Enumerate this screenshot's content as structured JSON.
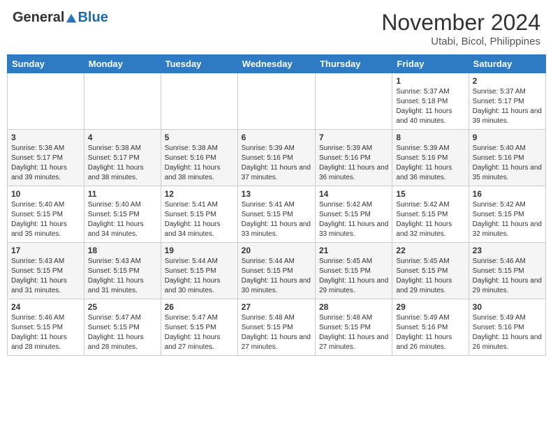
{
  "header": {
    "logo_general": "General",
    "logo_blue": "Blue",
    "month_title": "November 2024",
    "location": "Utabi, Bicol, Philippines"
  },
  "days_of_week": [
    "Sunday",
    "Monday",
    "Tuesday",
    "Wednesday",
    "Thursday",
    "Friday",
    "Saturday"
  ],
  "weeks": [
    [
      {
        "day": "",
        "info": ""
      },
      {
        "day": "",
        "info": ""
      },
      {
        "day": "",
        "info": ""
      },
      {
        "day": "",
        "info": ""
      },
      {
        "day": "",
        "info": ""
      },
      {
        "day": "1",
        "info": "Sunrise: 5:37 AM\nSunset: 5:18 PM\nDaylight: 11 hours and 40 minutes."
      },
      {
        "day": "2",
        "info": "Sunrise: 5:37 AM\nSunset: 5:17 PM\nDaylight: 11 hours and 39 minutes."
      }
    ],
    [
      {
        "day": "3",
        "info": "Sunrise: 5:38 AM\nSunset: 5:17 PM\nDaylight: 11 hours and 39 minutes."
      },
      {
        "day": "4",
        "info": "Sunrise: 5:38 AM\nSunset: 5:17 PM\nDaylight: 11 hours and 38 minutes."
      },
      {
        "day": "5",
        "info": "Sunrise: 5:38 AM\nSunset: 5:16 PM\nDaylight: 11 hours and 38 minutes."
      },
      {
        "day": "6",
        "info": "Sunrise: 5:39 AM\nSunset: 5:16 PM\nDaylight: 11 hours and 37 minutes."
      },
      {
        "day": "7",
        "info": "Sunrise: 5:39 AM\nSunset: 5:16 PM\nDaylight: 11 hours and 36 minutes."
      },
      {
        "day": "8",
        "info": "Sunrise: 5:39 AM\nSunset: 5:16 PM\nDaylight: 11 hours and 36 minutes."
      },
      {
        "day": "9",
        "info": "Sunrise: 5:40 AM\nSunset: 5:16 PM\nDaylight: 11 hours and 35 minutes."
      }
    ],
    [
      {
        "day": "10",
        "info": "Sunrise: 5:40 AM\nSunset: 5:15 PM\nDaylight: 11 hours and 35 minutes."
      },
      {
        "day": "11",
        "info": "Sunrise: 5:40 AM\nSunset: 5:15 PM\nDaylight: 11 hours and 34 minutes."
      },
      {
        "day": "12",
        "info": "Sunrise: 5:41 AM\nSunset: 5:15 PM\nDaylight: 11 hours and 34 minutes."
      },
      {
        "day": "13",
        "info": "Sunrise: 5:41 AM\nSunset: 5:15 PM\nDaylight: 11 hours and 33 minutes."
      },
      {
        "day": "14",
        "info": "Sunrise: 5:42 AM\nSunset: 5:15 PM\nDaylight: 11 hours and 33 minutes."
      },
      {
        "day": "15",
        "info": "Sunrise: 5:42 AM\nSunset: 5:15 PM\nDaylight: 11 hours and 32 minutes."
      },
      {
        "day": "16",
        "info": "Sunrise: 5:42 AM\nSunset: 5:15 PM\nDaylight: 11 hours and 32 minutes."
      }
    ],
    [
      {
        "day": "17",
        "info": "Sunrise: 5:43 AM\nSunset: 5:15 PM\nDaylight: 11 hours and 31 minutes."
      },
      {
        "day": "18",
        "info": "Sunrise: 5:43 AM\nSunset: 5:15 PM\nDaylight: 11 hours and 31 minutes."
      },
      {
        "day": "19",
        "info": "Sunrise: 5:44 AM\nSunset: 5:15 PM\nDaylight: 11 hours and 30 minutes."
      },
      {
        "day": "20",
        "info": "Sunrise: 5:44 AM\nSunset: 5:15 PM\nDaylight: 11 hours and 30 minutes."
      },
      {
        "day": "21",
        "info": "Sunrise: 5:45 AM\nSunset: 5:15 PM\nDaylight: 11 hours and 29 minutes."
      },
      {
        "day": "22",
        "info": "Sunrise: 5:45 AM\nSunset: 5:15 PM\nDaylight: 11 hours and 29 minutes."
      },
      {
        "day": "23",
        "info": "Sunrise: 5:46 AM\nSunset: 5:15 PM\nDaylight: 11 hours and 29 minutes."
      }
    ],
    [
      {
        "day": "24",
        "info": "Sunrise: 5:46 AM\nSunset: 5:15 PM\nDaylight: 11 hours and 28 minutes."
      },
      {
        "day": "25",
        "info": "Sunrise: 5:47 AM\nSunset: 5:15 PM\nDaylight: 11 hours and 28 minutes."
      },
      {
        "day": "26",
        "info": "Sunrise: 5:47 AM\nSunset: 5:15 PM\nDaylight: 11 hours and 27 minutes."
      },
      {
        "day": "27",
        "info": "Sunrise: 5:48 AM\nSunset: 5:15 PM\nDaylight: 11 hours and 27 minutes."
      },
      {
        "day": "28",
        "info": "Sunrise: 5:48 AM\nSunset: 5:15 PM\nDaylight: 11 hours and 27 minutes."
      },
      {
        "day": "29",
        "info": "Sunrise: 5:49 AM\nSunset: 5:16 PM\nDaylight: 11 hours and 26 minutes."
      },
      {
        "day": "30",
        "info": "Sunrise: 5:49 AM\nSunset: 5:16 PM\nDaylight: 11 hours and 26 minutes."
      }
    ]
  ]
}
